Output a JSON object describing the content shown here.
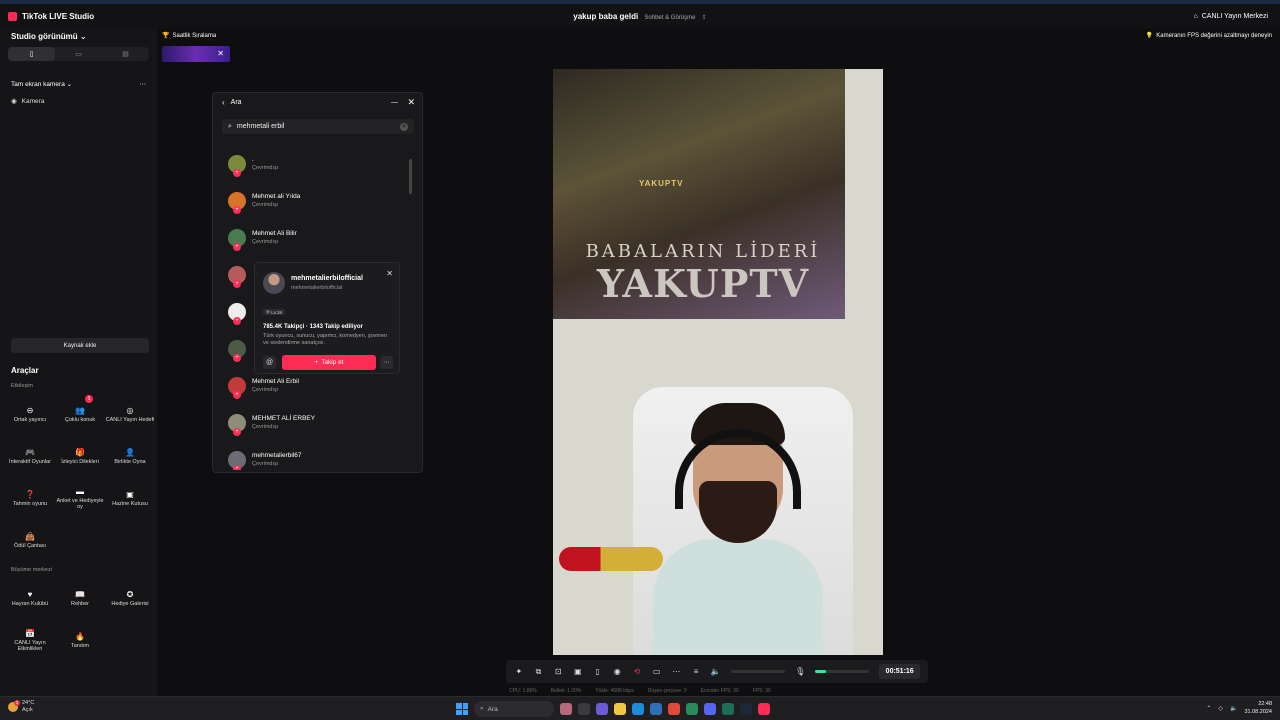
{
  "app": {
    "title": "TikTok LIVE Studio"
  },
  "header": {
    "stream_title": "yakup baba geldi",
    "category": "Sohbet & Görüşme",
    "live_center": "CANLI Yayın Merkezi"
  },
  "leaderboard_tab": "Saatlik Sıralama",
  "fps_tip": "Kameranın FPS değerini azaltmayı deneyin",
  "sidebar": {
    "studio_view": "Studio görünümü",
    "scene": "Tam ekran kamera",
    "sources": [
      {
        "label": "Kamera"
      }
    ],
    "add_source": "Kaynak ekle"
  },
  "tools": {
    "title": "Araçlar",
    "groups": [
      {
        "title": "Etkileşim",
        "items": [
          {
            "label": "Ortak yayıncı",
            "icon": "link-icon"
          },
          {
            "label": "Çoklu konuk",
            "icon": "users-icon",
            "badge": "1"
          },
          {
            "label": "CANLI Yayın Hedefi",
            "icon": "target-icon"
          },
          {
            "label": "İnteraktif Oyunlar",
            "icon": "gamepad-icon"
          },
          {
            "label": "İzleyici Dilekleri",
            "icon": "gift-icon"
          },
          {
            "label": "Birlikte Oyna",
            "icon": "person-icon"
          },
          {
            "label": "Tahmin oyunu",
            "icon": "question-icon"
          },
          {
            "label": "Anket ve Hediyeyle oy",
            "icon": "poll-icon"
          },
          {
            "label": "Hazine Kutusu",
            "icon": "chest-icon"
          },
          {
            "label": "Ödül Çantası",
            "icon": "bag-icon"
          }
        ]
      },
      {
        "title": "Büyüme merkezi",
        "items": [
          {
            "label": "Hayran Kulübü",
            "icon": "heart-icon"
          },
          {
            "label": "Rehber",
            "icon": "book-icon"
          },
          {
            "label": "Hediye Galerisi",
            "icon": "gallery-icon"
          },
          {
            "label": "CANLI Yayın Etkinlikleri",
            "icon": "calendar-icon"
          },
          {
            "label": "Tanıtım",
            "icon": "flame-icon"
          }
        ]
      }
    ]
  },
  "search": {
    "header": "Ara",
    "query": "mehmetali erbil",
    "results": [
      {
        "name": ".",
        "status": "Çevrimdışı",
        "color": "#7a8a3a"
      },
      {
        "name": "Mehmet ali Yılda",
        "status": "Çevrimdışı",
        "color": "#d8732a"
      },
      {
        "name": "Mehmet Ali Bilir",
        "status": "Çevrimdışı",
        "color": "#4a7a4f"
      },
      {
        "name": "",
        "status": "",
        "color": "#b55b5b"
      },
      {
        "name": "",
        "status": "",
        "color": "#ededed"
      },
      {
        "name": "",
        "status": "",
        "color": "#4d5a46"
      },
      {
        "name": "Mehmet Ali Erbil",
        "status": "Çevrimdışı",
        "color": "#c23a3a"
      },
      {
        "name": "MEHMET ALİ ERBEY",
        "status": "Çevrimdışı",
        "color": "#8d8d7a"
      },
      {
        "name": "mehmetalierbil67",
        "status": "Çevrimdışı",
        "color": "#6c6c76"
      }
    ]
  },
  "profile_card": {
    "name": "mehmetalierbilofficial",
    "handle": "mehmetalierbilofficial",
    "level": "Lv.19",
    "stats": "785.4K Takipçi · 1343 Takip ediliyor",
    "bio": "Türk oyuncu, sunucu, yapımcı, komedyen, şovmen ve seslendirme sanatçısı.",
    "mention": "@",
    "follow_label": "Takip et",
    "more": "···"
  },
  "preview": {
    "poster_brand": "YAKUPTV",
    "poster_subtitle": "BABALARIN LİDERİ",
    "poster_title": "YAKUPTV"
  },
  "controls": {
    "timer": "00:51:16",
    "mic_level": 0.2
  },
  "statusbar": [
    "CPU: 1.86%",
    "Bellek: 1.00%",
    "Yükle: 4588 kbps",
    "Düşen çerçeve: 0",
    "Encoder FPS: 30",
    "FPS: 30"
  ],
  "taskbar": {
    "weather_temp": "24°C",
    "weather_status": "Açık",
    "search_placeholder": "Ara",
    "time": "22:48",
    "date": "31.08.2024"
  }
}
